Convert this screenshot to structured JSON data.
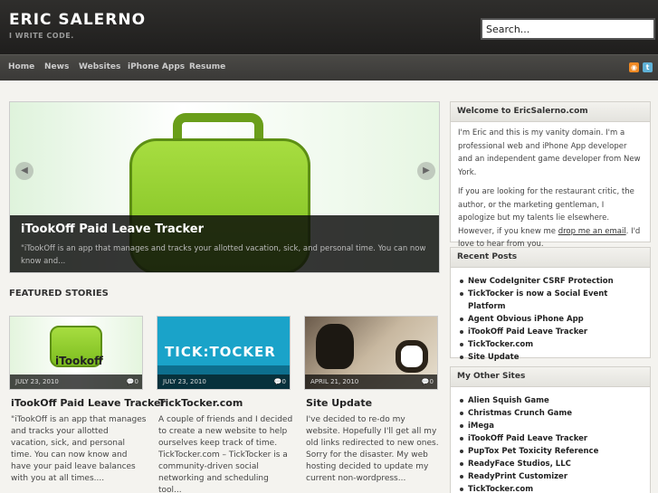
{
  "header": {
    "title": "ERIC SALERNO",
    "tagline": "I WRITE CODE.",
    "search_placeholder": "Search..."
  },
  "nav": {
    "items": [
      "Home",
      "News",
      "Websites",
      "iPhone Apps",
      "Resume"
    ],
    "feed_icon": "rss-icon",
    "twitter_icon": "twitter-icon"
  },
  "slider": {
    "title": "iTookOff Paid Leave Tracker",
    "excerpt": "\"iTookOff is an app that manages and tracks your allotted vacation, sick, and personal time. You can now know and...",
    "image_text": "iTookoff",
    "prev_icon": "prev-arrow-icon",
    "next_icon": "next-arrow-icon"
  },
  "featured": {
    "heading": "FEATURED STORIES",
    "cards": [
      {
        "date": "JULY 23, 2010",
        "comments": "0",
        "title": "iTookOff Paid Leave Tracker",
        "text": "\"iTookOff is an app that manages and tracks your allotted vacation, sick, and personal time. You can now know and have your paid leave balances with you at all times...."
      },
      {
        "date": "JULY 23, 2010",
        "comments": "0",
        "title": "TickTocker.com",
        "text": "A couple of friends and I decided to create a new website to help ourselves keep track of time. TickTocker.com – TickTocker is a community-driven social networking and scheduling tool..."
      },
      {
        "date": "APRIL 21, 2010",
        "comments": "0",
        "title": "Site Update",
        "text": "I've decided to re-do my website. Hopefully I'll get all my old links redirected to new ones. Sorry for the disaster. My web hosting decided to update my current non-wordpress..."
      }
    ]
  },
  "sidebar": {
    "welcome": {
      "title": "Welcome to EricSalerno.com",
      "p1": "I'm Eric and this is my vanity domain. I'm a professional web and iPhone App developer and an independent game developer from New York.",
      "p2_before": "If you are looking for the restaurant critic, the author, or the marketing gentleman, I apologize but my talents lie elsewhere. However, if you knew me ",
      "p2_link": "drop me an email",
      "p2_after": ". I'd love to hear from you."
    },
    "recent_posts": {
      "title": "Recent Posts",
      "items": [
        "New CodeIgniter CSRF Protection",
        "TickTocker is now a Social Event Platform",
        "Agent Obvious iPhone App",
        "iTookOff Paid Leave Tracker",
        "TickTocker.com",
        "Site Update"
      ]
    },
    "other_sites": {
      "title": "My Other Sites",
      "items": [
        "Alien Squish Game",
        "Christmas Crunch Game",
        "iMega",
        "iTookOff Paid Leave Tracker",
        "PupTox Pet Toxicity Reference",
        "ReadyFace Studios, LLC",
        "ReadyPrint Customizer",
        "TickTocker.com"
      ]
    }
  }
}
